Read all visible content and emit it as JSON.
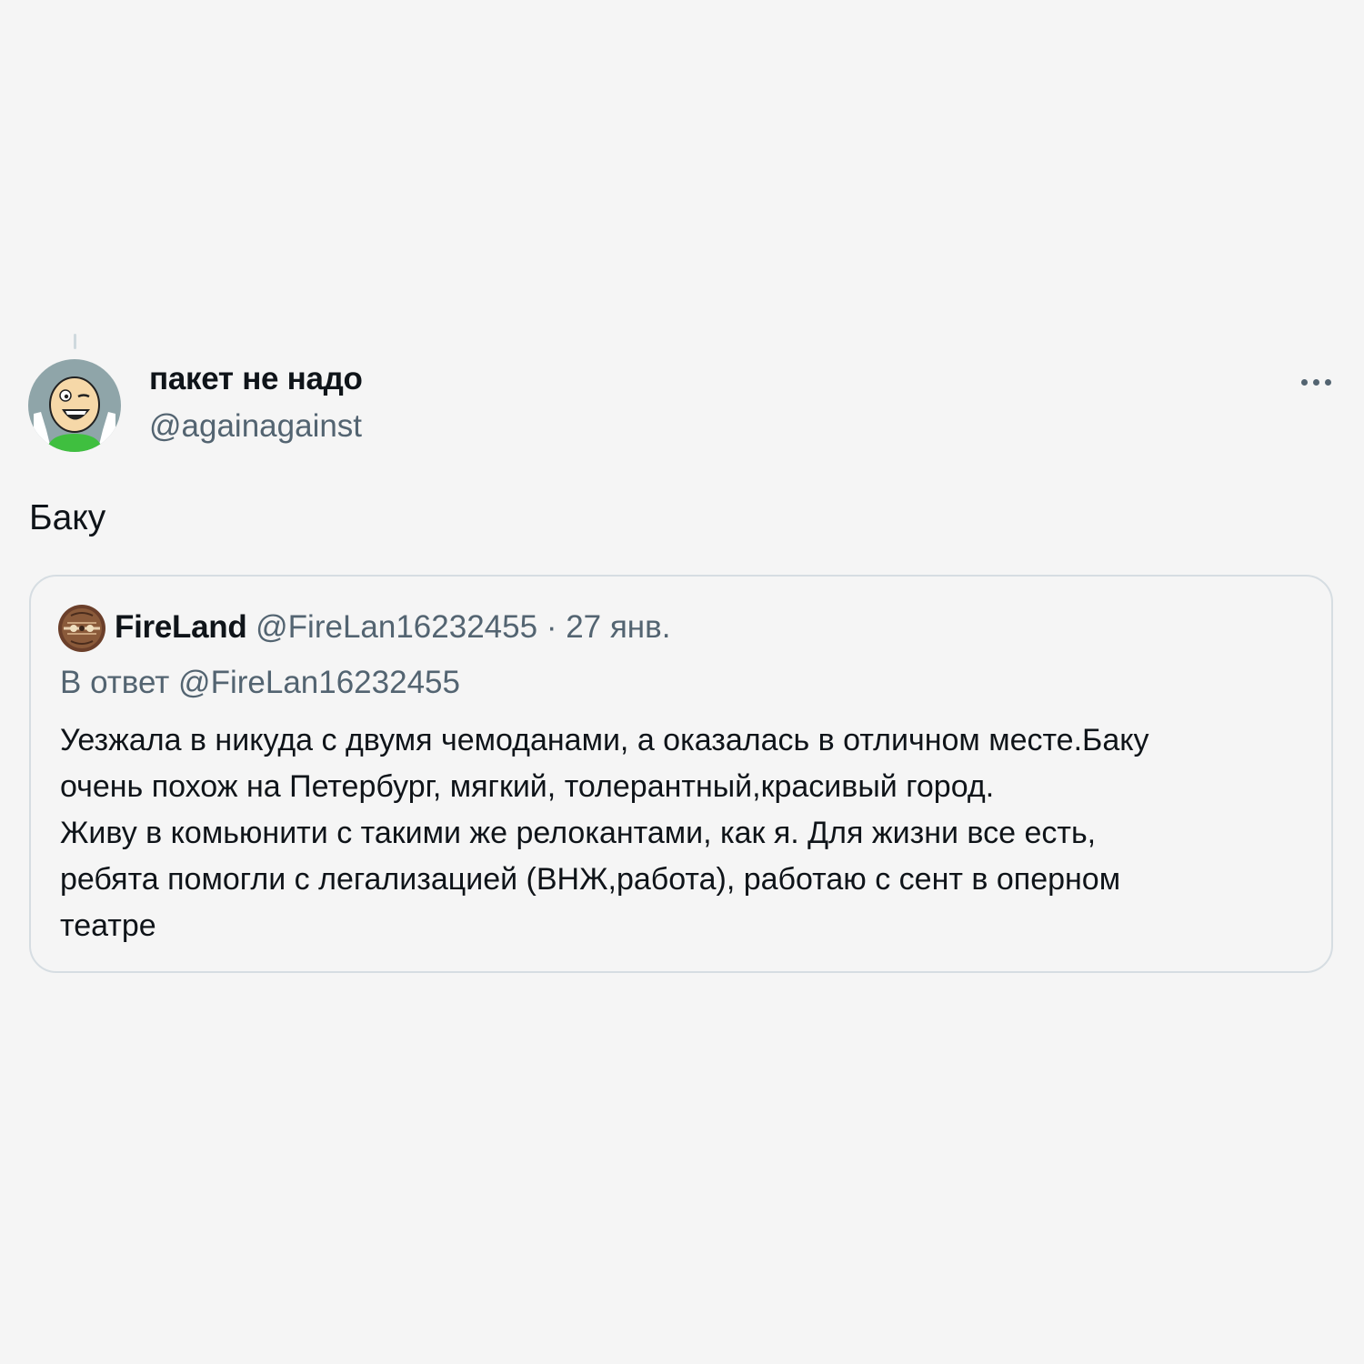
{
  "tweet": {
    "author": {
      "display_name": "пакет не надо",
      "handle": "@againagainst",
      "avatar_icon": "cartoon-face-avatar"
    },
    "more_icon": "more-dots-icon",
    "text": "Баку"
  },
  "quoted_tweet": {
    "author": {
      "display_name": "FireLand",
      "handle": "@FireLan16232455",
      "avatar_icon": "pattern-avatar"
    },
    "separator": "·",
    "date": "27 янв.",
    "reply_to": "В ответ @FireLan16232455",
    "lines": [
      "Уезжала в никуда с двумя чемоданами, а оказалась в отличном месте.Баку",
      "очень похож на Петербург, мягкий, толерантный,красивый город.",
      "Живу в комьюнити с такими же релокантами, как я. Для жизни все есть,",
      "ребята помогли с легализацией (ВНЖ,работа), работаю с сент в оперном",
      "театре"
    ]
  },
  "colors": {
    "background": "#f5f5f5",
    "text_primary": "#0f1419",
    "text_secondary": "#536471",
    "border": "#d6dde2"
  }
}
